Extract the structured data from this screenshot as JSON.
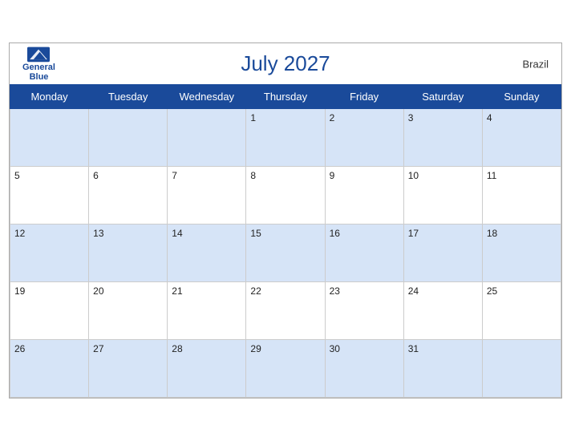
{
  "header": {
    "title": "July 2027",
    "country": "Brazil",
    "brand": {
      "line1": "General",
      "line2": "Blue"
    }
  },
  "weekdays": [
    "Monday",
    "Tuesday",
    "Wednesday",
    "Thursday",
    "Friday",
    "Saturday",
    "Sunday"
  ],
  "rows": [
    [
      "",
      "",
      "",
      "1",
      "2",
      "3",
      "4"
    ],
    [
      "5",
      "6",
      "7",
      "8",
      "9",
      "10",
      "11"
    ],
    [
      "12",
      "13",
      "14",
      "15",
      "16",
      "17",
      "18"
    ],
    [
      "19",
      "20",
      "21",
      "22",
      "23",
      "24",
      "25"
    ],
    [
      "26",
      "27",
      "28",
      "29",
      "30",
      "31",
      ""
    ]
  ]
}
